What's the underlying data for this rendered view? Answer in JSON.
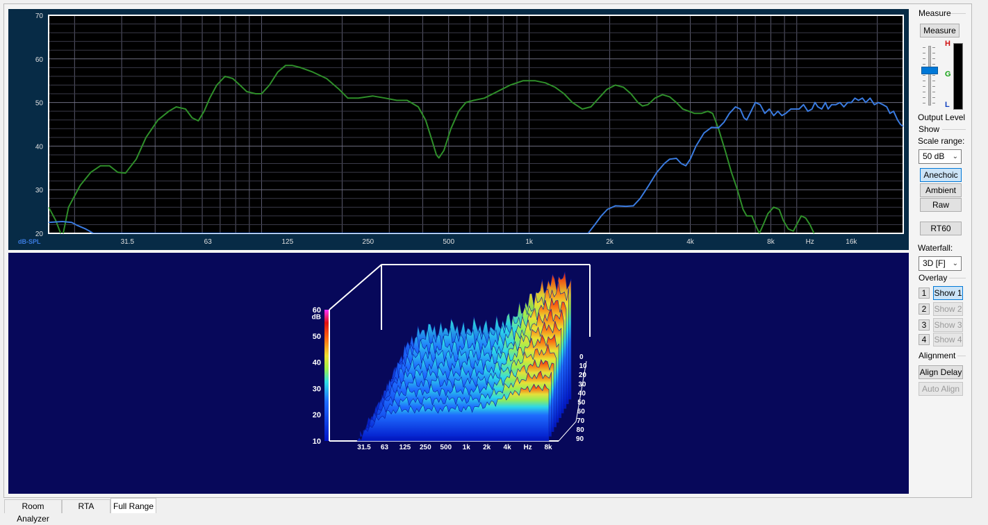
{
  "tabs": [
    {
      "label": "Room Analyzer",
      "active": false
    },
    {
      "label": "RTA",
      "active": false
    },
    {
      "label": "Full Range",
      "active": true
    }
  ],
  "side": {
    "measure_group": "Measure",
    "measure_button": "Measure",
    "meter_labels": {
      "h": "H",
      "g": "G",
      "l": "L"
    },
    "output_level_label": "Output Level",
    "output_level": 0.62,
    "show_group": "Show",
    "scale_range_label": "Scale range:",
    "scale_range_value": "50 dB",
    "anechoic": "Anechoic",
    "ambient": "Ambient",
    "raw": "Raw",
    "rt60": "RT60",
    "waterfall_label": "Waterfall:",
    "waterfall_value": "3D [F]",
    "overlay_group": "Overlay",
    "overlays": [
      {
        "num": "1",
        "label": "Show 1",
        "enabled": true
      },
      {
        "num": "2",
        "label": "Show 2",
        "enabled": false
      },
      {
        "num": "3",
        "label": "Show 3",
        "enabled": false
      },
      {
        "num": "4",
        "label": "Show 4",
        "enabled": false
      }
    ],
    "alignment_group": "Alignment",
    "align_delay": "Align Delay",
    "auto_align": "Auto Align"
  },
  "colors": {
    "green_trace": "#2f8f2a",
    "blue_trace": "#3a7be0",
    "grid": "#5a5a6e",
    "plot_bg": "#000000"
  },
  "chart_data": [
    {
      "type": "line",
      "ylabel": "dB-SPL",
      "xunit": "Hz",
      "xscale": "log",
      "xlim": [
        16,
        25000
      ],
      "ylim": [
        20,
        70
      ],
      "yticks": [
        "70",
        "60",
        "50",
        "40",
        "30",
        "20"
      ],
      "xticks": [
        {
          "label": "31.5",
          "f": 31.5
        },
        {
          "label": "63",
          "f": 63
        },
        {
          "label": "125",
          "f": 125
        },
        {
          "label": "250",
          "f": 250
        },
        {
          "label": "500",
          "f": 500
        },
        {
          "label": "1k",
          "f": 1000
        },
        {
          "label": "2k",
          "f": 2000
        },
        {
          "label": "4k",
          "f": 4000
        },
        {
          "label": "8k",
          "f": 8000
        },
        {
          "label": "Hz",
          "f": 11200
        },
        {
          "label": "16k",
          "f": 16000
        }
      ],
      "series": [
        {
          "color": "#2f8f2a",
          "points": [
            [
              16,
              26
            ],
            [
              17,
              23
            ],
            [
              18,
              19
            ],
            [
              19,
              26
            ],
            [
              21,
              31
            ],
            [
              23,
              34
            ],
            [
              25,
              35.5
            ],
            [
              27,
              35.5
            ],
            [
              29,
              34
            ],
            [
              31,
              33.8
            ],
            [
              34,
              37
            ],
            [
              37,
              42
            ],
            [
              41,
              46
            ],
            [
              45,
              48
            ],
            [
              48,
              49
            ],
            [
              52,
              48.5
            ],
            [
              55,
              46.5
            ],
            [
              58,
              45.8
            ],
            [
              61,
              48
            ],
            [
              64,
              51
            ],
            [
              68,
              54
            ],
            [
              73,
              56
            ],
            [
              78,
              55.5
            ],
            [
              83,
              54
            ],
            [
              88,
              52.5
            ],
            [
              95,
              52
            ],
            [
              100,
              52
            ],
            [
              107,
              54
            ],
            [
              115,
              57
            ],
            [
              123,
              58.5
            ],
            [
              130,
              58.5
            ],
            [
              140,
              58
            ],
            [
              155,
              57
            ],
            [
              175,
              55.5
            ],
            [
              195,
              53
            ],
            [
              210,
              51
            ],
            [
              230,
              51
            ],
            [
              260,
              51.5
            ],
            [
              290,
              51
            ],
            [
              320,
              50.5
            ],
            [
              350,
              50.5
            ],
            [
              385,
              49
            ],
            [
              410,
              46
            ],
            [
              435,
              41
            ],
            [
              450,
              38
            ],
            [
              460,
              37.3
            ],
            [
              480,
              39
            ],
            [
              510,
              44
            ],
            [
              545,
              48
            ],
            [
              580,
              50
            ],
            [
              620,
              50.5
            ],
            [
              680,
              51
            ],
            [
              760,
              52.5
            ],
            [
              850,
              54
            ],
            [
              950,
              55
            ],
            [
              1050,
              55
            ],
            [
              1150,
              54.5
            ],
            [
              1250,
              53.5
            ],
            [
              1350,
              52
            ],
            [
              1450,
              50
            ],
            [
              1580,
              48.5
            ],
            [
              1700,
              49
            ],
            [
              1820,
              51
            ],
            [
              1950,
              53
            ],
            [
              2100,
              54
            ],
            [
              2250,
              53.5
            ],
            [
              2400,
              52
            ],
            [
              2550,
              50
            ],
            [
              2650,
              49.2
            ],
            [
              2780,
              49.5
            ],
            [
              2950,
              51
            ],
            [
              3150,
              51.8
            ],
            [
              3350,
              51.3
            ],
            [
              3550,
              50
            ],
            [
              3750,
              48.5
            ],
            [
              3950,
              48
            ],
            [
              4150,
              47.5
            ],
            [
              4400,
              47.5
            ],
            [
              4650,
              48
            ],
            [
              4850,
              47.5
            ],
            [
              5100,
              44
            ],
            [
              5400,
              39
            ],
            [
              5700,
              34
            ],
            [
              6000,
              30
            ],
            [
              6300,
              25.5
            ],
            [
              6500,
              24
            ],
            [
              6800,
              24
            ],
            [
              7000,
              22
            ],
            [
              7250,
              20
            ],
            [
              7500,
              22
            ],
            [
              7800,
              24.5
            ],
            [
              8200,
              26
            ],
            [
              8600,
              25.5
            ],
            [
              8900,
              23
            ],
            [
              9300,
              21
            ],
            [
              9700,
              20.5
            ],
            [
              10000,
              22
            ],
            [
              10400,
              24
            ],
            [
              10800,
              23.5
            ],
            [
              11200,
              22
            ],
            [
              11600,
              20
            ]
          ]
        },
        {
          "color": "#3a7be0",
          "points": [
            [
              16,
              22.5
            ],
            [
              18,
              22.7
            ],
            [
              19.5,
              22.5
            ],
            [
              20.5,
              21.8
            ],
            [
              22,
              21
            ],
            [
              23.5,
              20
            ],
            [
              1660,
              20
            ],
            [
              1760,
              22
            ],
            [
              1860,
              24
            ],
            [
              1960,
              25.5
            ],
            [
              2100,
              26.3
            ],
            [
              2300,
              26.2
            ],
            [
              2450,
              26.3
            ],
            [
              2600,
              28
            ],
            [
              2800,
              31
            ],
            [
              3000,
              34
            ],
            [
              3200,
              36
            ],
            [
              3350,
              37
            ],
            [
              3550,
              37.2
            ],
            [
              3700,
              36
            ],
            [
              3850,
              35.5
            ],
            [
              4000,
              37
            ],
            [
              4200,
              40
            ],
            [
              4500,
              43
            ],
            [
              4800,
              44.3
            ],
            [
              5100,
              44.2
            ],
            [
              5350,
              45.5
            ],
            [
              5600,
              47.5
            ],
            [
              5900,
              49
            ],
            [
              6150,
              48.5
            ],
            [
              6350,
              46.5
            ],
            [
              6500,
              46
            ],
            [
              6750,
              48
            ],
            [
              7000,
              50
            ],
            [
              7300,
              49.5
            ],
            [
              7600,
              47.5
            ],
            [
              7900,
              48.5
            ],
            [
              8200,
              47
            ],
            [
              8500,
              48
            ],
            [
              8800,
              47
            ],
            [
              9100,
              47.5
            ],
            [
              9500,
              48.5
            ],
            [
              9800,
              48.5
            ],
            [
              10200,
              48.5
            ],
            [
              10600,
              49.5
            ],
            [
              11000,
              48
            ],
            [
              11400,
              48.5
            ],
            [
              11700,
              50
            ],
            [
              12000,
              49
            ],
            [
              12400,
              48.5
            ],
            [
              12800,
              50
            ],
            [
              13100,
              48.5
            ],
            [
              13500,
              49.5
            ],
            [
              14000,
              49.5
            ],
            [
              14500,
              50
            ],
            [
              15000,
              49
            ],
            [
              15500,
              50
            ],
            [
              16000,
              50
            ],
            [
              16500,
              51
            ],
            [
              17000,
              50.5
            ],
            [
              17600,
              51
            ],
            [
              18100,
              50
            ],
            [
              18800,
              51
            ],
            [
              19500,
              49.5
            ],
            [
              20200,
              50
            ],
            [
              21000,
              49.5
            ],
            [
              21700,
              49
            ],
            [
              22300,
              47.5
            ],
            [
              23000,
              48
            ],
            [
              23800,
              46
            ],
            [
              24400,
              45
            ],
            [
              25000,
              44.5
            ]
          ]
        }
      ]
    },
    {
      "type": "area",
      "zlabel": "dB",
      "zlim": [
        10,
        60
      ],
      "zticks": [
        "60",
        "50",
        "40",
        "30",
        "20",
        "10"
      ],
      "xticks": [
        "31.5",
        "63",
        "125",
        "250",
        "500",
        "1k",
        "2k",
        "4k",
        "Hz",
        "8k"
      ],
      "time_ticks": [
        "0",
        "10",
        "20",
        "30",
        "40",
        "50",
        "60",
        "70",
        "80",
        "90"
      ],
      "profile": [
        {
          "x": 0.08,
          "level": 24
        },
        {
          "x": 0.12,
          "level": 30
        },
        {
          "x": 0.18,
          "level": 35
        },
        {
          "x": 0.24,
          "level": 37
        },
        {
          "x": 0.3,
          "level": 36
        },
        {
          "x": 0.36,
          "level": 38
        },
        {
          "x": 0.42,
          "level": 36
        },
        {
          "x": 0.48,
          "level": 38
        },
        {
          "x": 0.54,
          "level": 37
        },
        {
          "x": 0.6,
          "level": 38
        },
        {
          "x": 0.66,
          "level": 40
        },
        {
          "x": 0.72,
          "level": 43
        },
        {
          "x": 0.78,
          "level": 48
        },
        {
          "x": 0.84,
          "level": 52
        },
        {
          "x": 0.9,
          "level": 55
        },
        {
          "x": 0.96,
          "level": 56
        },
        {
          "x": 1.0,
          "level": 54
        }
      ]
    }
  ]
}
